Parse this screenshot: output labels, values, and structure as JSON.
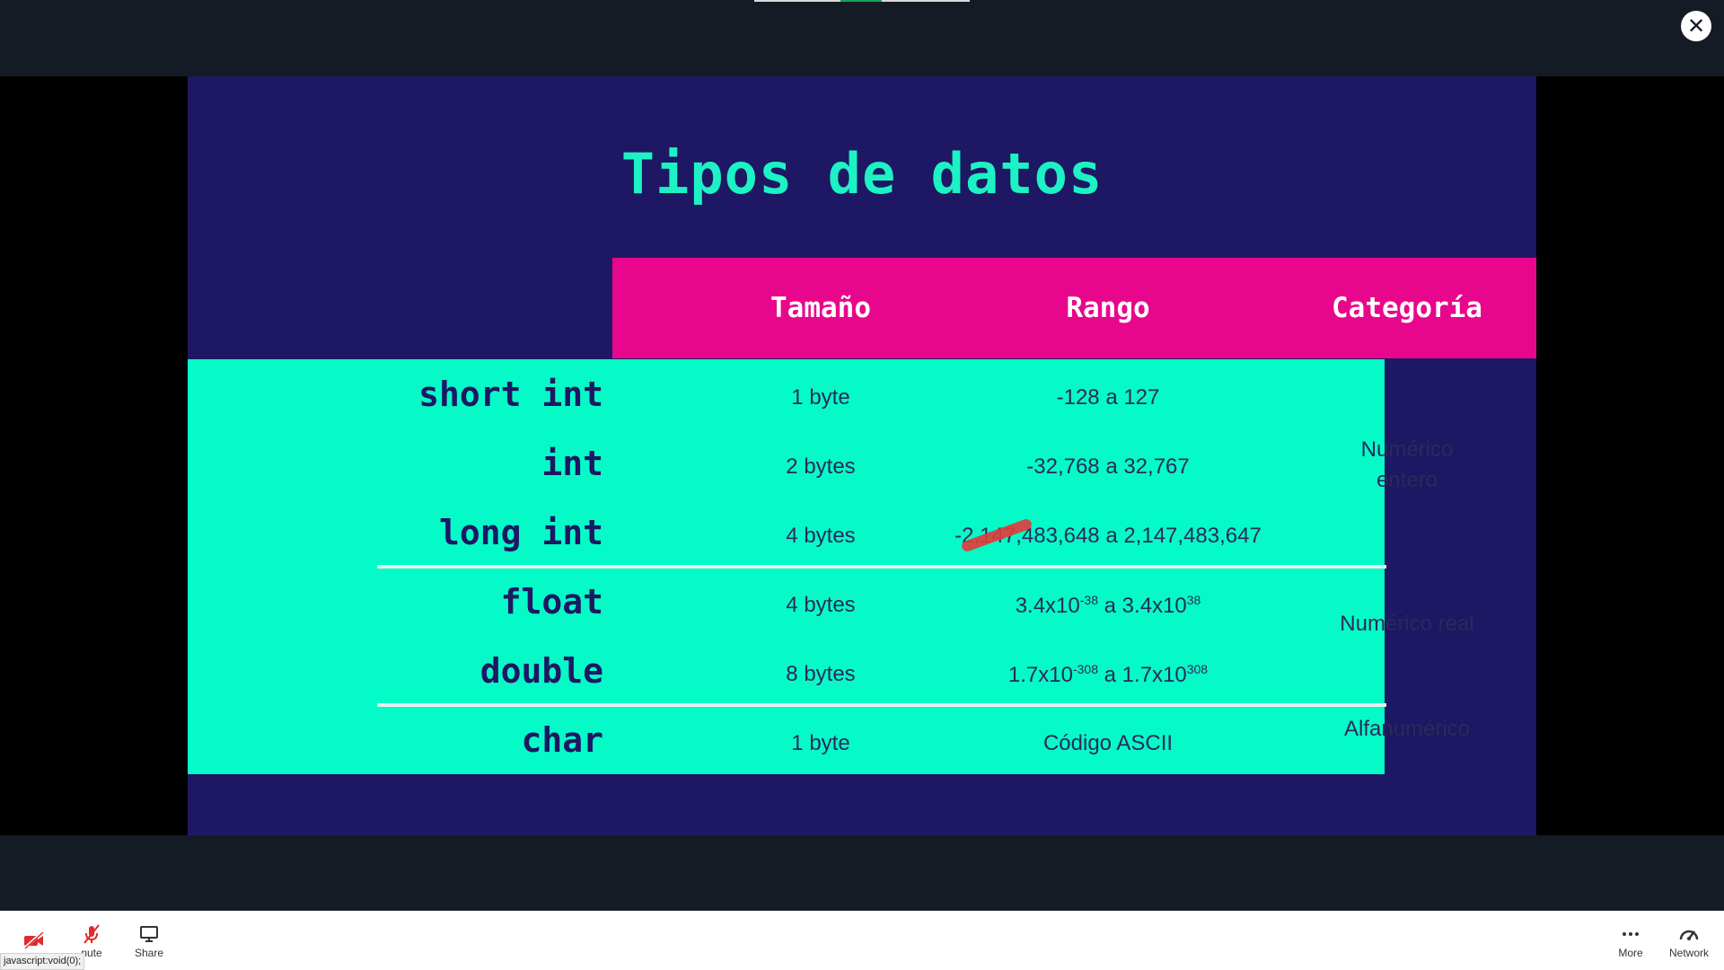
{
  "colors": {
    "window_bg": "#151b24",
    "slide_bg": "#1e1763",
    "title": "#1cf2c4",
    "header": "#e8078c",
    "table": "#04fbc7",
    "text": "#2a2a5a"
  },
  "close_button": {
    "icon": "close-icon",
    "label": "✕"
  },
  "slide": {
    "title": "Tipos de datos",
    "headers": {
      "size": "Tamaño",
      "range": "Rango",
      "category": "Categoría"
    },
    "rows": [
      {
        "type": "short int",
        "size": "1 byte",
        "range": "-128 a 127"
      },
      {
        "type": "int",
        "size": "2 bytes",
        "range": "-32,768 a 32,767"
      },
      {
        "type": "long int",
        "size": "4 bytes",
        "range": "-2,147,483,648 a 2,147,483,647"
      },
      {
        "type": "float",
        "size": "4 bytes",
        "range": {
          "a": "3.4x10",
          "a_exp": "-38",
          "sep": " a ",
          "b": "3.4x10",
          "b_exp": "38"
        }
      },
      {
        "type": "double",
        "size": "8 bytes",
        "range": {
          "a": "1.7x10",
          "a_exp": "-308",
          "sep": " a ",
          "b": "1.7x10",
          "b_exp": "308"
        }
      },
      {
        "type": "char",
        "size": "1 byte",
        "range": "Código ASCII"
      }
    ],
    "categories": {
      "integer_line1": "Numérico",
      "integer_line2": "entero",
      "real": "Numérico real",
      "alnum": "Alfanumérico"
    }
  },
  "toolbar": {
    "items": [
      {
        "label": "",
        "icon": "video-off-icon"
      },
      {
        "label": "nute",
        "icon": "mic-off-icon"
      },
      {
        "label": "Share",
        "icon": "screen-share-icon"
      },
      {
        "label": "More",
        "icon": "more-dots-icon"
      },
      {
        "label": "Network",
        "icon": "network-gauge-icon"
      }
    ]
  },
  "status_bar": {
    "text": "javascript:void(0);"
  }
}
